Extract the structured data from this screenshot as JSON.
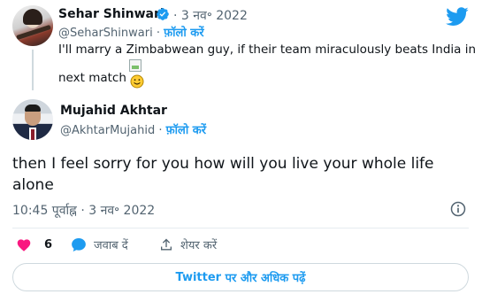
{
  "quoted_tweet": {
    "author_name": "Sehar Shinwari",
    "date_sep": "·",
    "date": "3 नव॰ 2022",
    "handle": "@SeharShinwari",
    "follow_sep": "·",
    "follow_label": "फ़ॉलो करें",
    "text_line1": "I'll marry a Zimbabwean guy, if their team miraculously beats India in",
    "text_line2": "next match"
  },
  "tweet": {
    "author_name": "Mujahid Akhtar",
    "handle": "@AkhtarMujahid",
    "follow_sep": "·",
    "follow_label": "फ़ॉलो करें",
    "text": "then I feel sorry for you how will you live your whole life alone",
    "timestamp": "10:45 पूर्वाह्न · 3 नव॰ 2022"
  },
  "actions": {
    "like_count": "6",
    "reply_label": "जवाब दें",
    "share_label": "शेयर करें"
  },
  "more_button": {
    "brand": "Twitter",
    "rest": " पर और अधिक पढ़ें"
  },
  "colors": {
    "accent": "#1d9bf0",
    "like": "#f91880",
    "secondary_text": "#536471"
  },
  "icons": [
    "verified-badge-icon",
    "twitter-bird-icon",
    "info-icon",
    "heart-icon",
    "reply-bubble-icon",
    "share-icon",
    "smiley-icon"
  ]
}
